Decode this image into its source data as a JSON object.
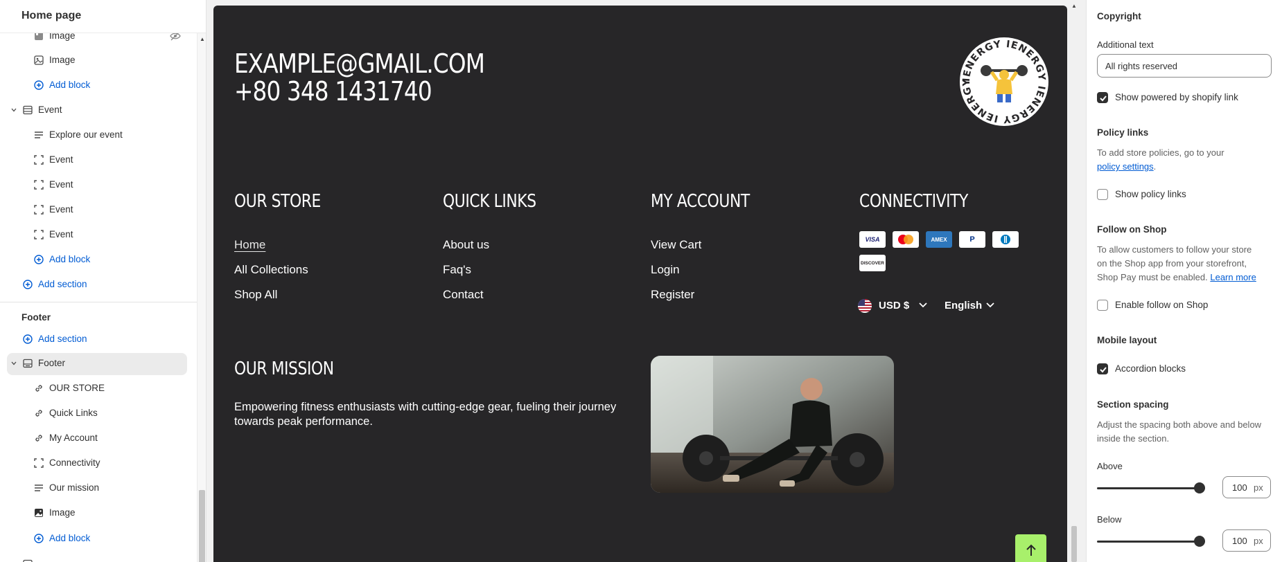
{
  "sidebar": {
    "title": "Home page",
    "rows": [
      {
        "label": "Image",
        "icon": "image-icon"
      },
      {
        "label": "Image",
        "icon": "image-icon"
      },
      {
        "label": "Add block",
        "icon": "add-circle-icon"
      },
      {
        "label": "Event",
        "icon": "section-icon"
      },
      {
        "label": "Explore our event",
        "icon": "text-icon"
      },
      {
        "label": "Event",
        "icon": "block-icon"
      },
      {
        "label": "Event",
        "icon": "block-icon"
      },
      {
        "label": "Event",
        "icon": "block-icon"
      },
      {
        "label": "Event",
        "icon": "block-icon"
      },
      {
        "label": "Add block",
        "icon": "add-circle-icon"
      },
      {
        "label": "Add section",
        "icon": "add-circle-icon"
      }
    ],
    "footer_group": {
      "label": "Footer",
      "add_section": "Add section",
      "footer_item": "Footer",
      "blocks": [
        {
          "label": "OUR STORE",
          "icon": "link-icon"
        },
        {
          "label": "Quick Links",
          "icon": "link-icon"
        },
        {
          "label": "My Account",
          "icon": "link-icon"
        },
        {
          "label": "Connectivity",
          "icon": "block-icon"
        },
        {
          "label": "Our mission",
          "icon": "text-icon"
        },
        {
          "label": "Image",
          "icon": "image-icon"
        }
      ],
      "add_block": "Add block"
    }
  },
  "preview": {
    "email": "EXAMPLE@GMAIL.COM",
    "phone": "+80 348 1431740",
    "logo_text": "IENERGY IENERGY IENERGY IENERGY",
    "columns": [
      {
        "heading": "OUR STORE",
        "links": [
          "Home",
          "All Collections",
          "Shop All"
        ]
      },
      {
        "heading": "QUICK LINKS",
        "links": [
          "About us",
          "Faq's",
          "Contact"
        ]
      },
      {
        "heading": "MY ACCOUNT",
        "links": [
          "View Cart",
          "Login",
          "Register"
        ]
      },
      {
        "heading": "CONNECTIVITY",
        "links": []
      }
    ],
    "payment_methods": [
      "VISA",
      "Mastercard",
      "AMEX",
      "PayPal",
      "Diners Club",
      "DISCOVER"
    ],
    "currency": "USD $",
    "language": "English",
    "mission_heading": "OUR MISSION",
    "mission_text": "Empowering fitness enthusiasts with cutting-edge gear, fueling their journey towards peak performance.",
    "colors": {
      "background": "#272628",
      "back_to_top": "#a8f06b"
    }
  },
  "settings": {
    "copyright_heading": "Copyright",
    "additional_text_label": "Additional text",
    "additional_text_value": "All rights reserved",
    "show_powered_by": "Show powered by shopify link",
    "policy_heading": "Policy links",
    "policy_help_prefix": "To add store policies, go to your",
    "policy_help_link": "policy settings",
    "show_policy_links": "Show policy links",
    "follow_heading": "Follow on Shop",
    "follow_help": "To allow customers to follow your store on the Shop app from your storefront, Shop Pay must be enabled.",
    "follow_learn_more": "Learn more",
    "enable_follow": "Enable follow on Shop",
    "mobile_heading": "Mobile layout",
    "accordion_blocks": "Accordion blocks",
    "spacing_heading": "Section spacing",
    "spacing_help": "Adjust the spacing both above and below inside the section.",
    "above_label": "Above",
    "above_value": "100",
    "below_label": "Below",
    "below_value": "100",
    "unit": "px",
    "slider_max": 100,
    "checks": {
      "powered_by": true,
      "policy_links": false,
      "follow_on_shop": false,
      "accordion": true
    }
  }
}
